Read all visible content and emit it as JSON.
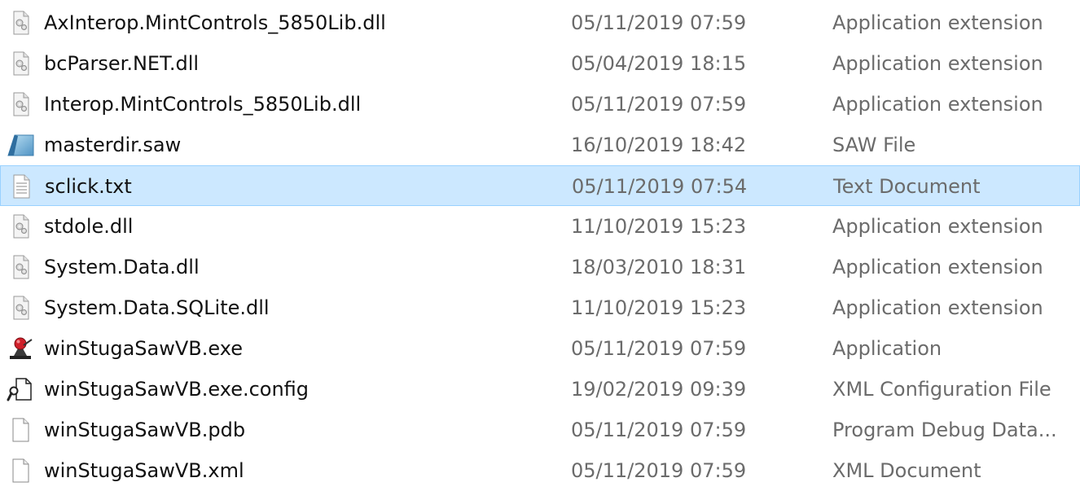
{
  "files": [
    {
      "name": "AxInterop.MintControls_5850Lib.dll",
      "date": "05/11/2019 07:59",
      "type": "Application extension",
      "icon": "dll-icon",
      "selected": false
    },
    {
      "name": "bcParser.NET.dll",
      "date": "05/04/2019 18:15",
      "type": "Application extension",
      "icon": "dll-icon",
      "selected": false
    },
    {
      "name": "Interop.MintControls_5850Lib.dll",
      "date": "05/11/2019 07:59",
      "type": "Application extension",
      "icon": "dll-icon",
      "selected": false
    },
    {
      "name": "masterdir.saw",
      "date": "16/10/2019 18:42",
      "type": "SAW File",
      "icon": "saw-file-icon",
      "selected": false
    },
    {
      "name": "sclick.txt",
      "date": "05/11/2019 07:54",
      "type": "Text Document",
      "icon": "text-file-icon",
      "selected": true
    },
    {
      "name": "stdole.dll",
      "date": "11/10/2019 15:23",
      "type": "Application extension",
      "icon": "dll-icon",
      "selected": false
    },
    {
      "name": "System.Data.dll",
      "date": "18/03/2010 18:31",
      "type": "Application extension",
      "icon": "dll-icon",
      "selected": false
    },
    {
      "name": "System.Data.SQLite.dll",
      "date": "11/10/2019 15:23",
      "type": "Application extension",
      "icon": "dll-icon",
      "selected": false
    },
    {
      "name": "winStugaSawVB.exe",
      "date": "05/11/2019 07:59",
      "type": "Application",
      "icon": "application-icon",
      "selected": false
    },
    {
      "name": "winStugaSawVB.exe.config",
      "date": "19/02/2019 09:39",
      "type": "XML Configuration File",
      "icon": "config-file-icon",
      "selected": false
    },
    {
      "name": "winStugaSawVB.pdb",
      "date": "05/11/2019 07:59",
      "type": "Program Debug Data...",
      "icon": "blank-file-icon",
      "selected": false
    },
    {
      "name": "winStugaSawVB.xml",
      "date": "05/11/2019 07:59",
      "type": "XML Document",
      "icon": "blank-file-icon",
      "selected": false
    }
  ],
  "colors": {
    "selection_background": "#cce8ff",
    "selection_border": "#99d1ff",
    "secondary_text": "#6b6b6b"
  }
}
